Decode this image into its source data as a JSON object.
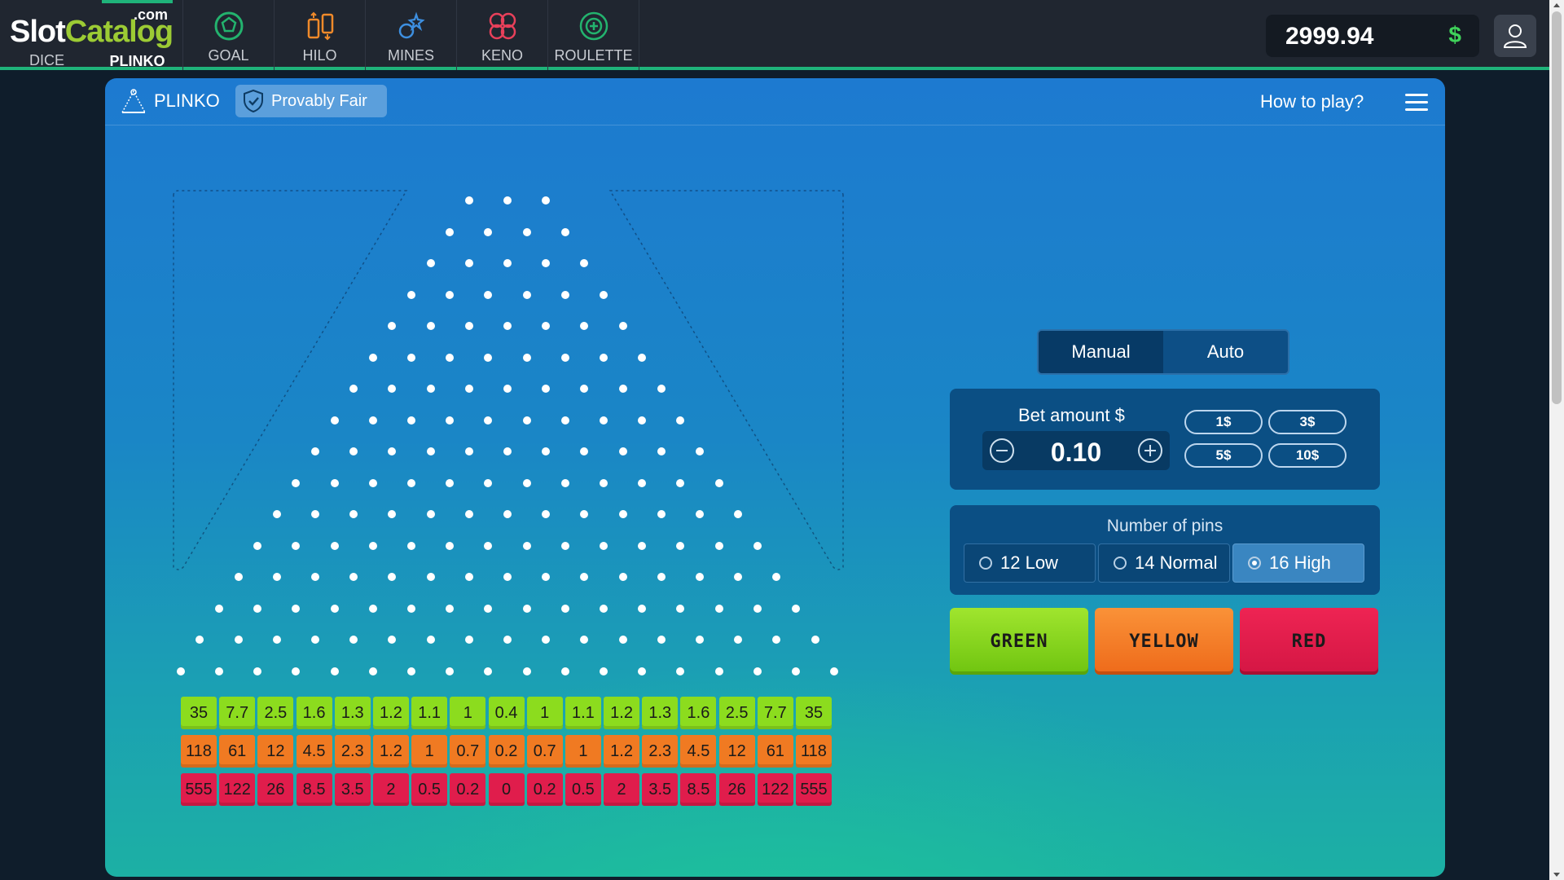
{
  "logo": {
    "brand_white": "Slot",
    "brand_green": "Catalog",
    "suffix": ".com"
  },
  "nav": {
    "items": [
      {
        "label": "DICE",
        "icon": "dice-icon"
      },
      {
        "label": "PLINKO",
        "icon": "plinko-icon",
        "active": true
      },
      {
        "label": "GOAL",
        "icon": "soccer-ball-icon"
      },
      {
        "label": "HILO",
        "icon": "hilo-icon"
      },
      {
        "label": "MINES",
        "icon": "mines-icon"
      },
      {
        "label": "KENO",
        "icon": "keno-icon"
      },
      {
        "label": "ROULETTE",
        "icon": "roulette-icon"
      }
    ]
  },
  "balance": {
    "amount": "2999.94",
    "currency": "$"
  },
  "game": {
    "title": "PLINKO",
    "provably_fair": "Provably Fair",
    "how_to_play": "How to play?"
  },
  "board": {
    "pin_rows": 16,
    "multipliers": {
      "green": [
        "35",
        "7.7",
        "2.5",
        "1.6",
        "1.3",
        "1.2",
        "1.1",
        "1",
        "0.4",
        "1",
        "1.1",
        "1.2",
        "1.3",
        "1.6",
        "2.5",
        "7.7",
        "35"
      ],
      "yellow": [
        "118",
        "61",
        "12",
        "4.5",
        "2.3",
        "1.2",
        "1",
        "0.7",
        "0.2",
        "0.7",
        "1",
        "1.2",
        "2.3",
        "4.5",
        "12",
        "61",
        "118"
      ],
      "red": [
        "555",
        "122",
        "26",
        "8.5",
        "3.5",
        "2",
        "0.5",
        "0.2",
        "0",
        "0.2",
        "0.5",
        "2",
        "3.5",
        "8.5",
        "26",
        "122",
        "555"
      ]
    }
  },
  "controls": {
    "mode": {
      "manual": "Manual",
      "auto": "Auto",
      "selected": "Manual"
    },
    "bet": {
      "label": "Bet amount $",
      "value": "0.10",
      "chips": [
        "1$",
        "3$",
        "5$",
        "10$"
      ]
    },
    "pins": {
      "label": "Number of pins",
      "options": [
        "12 Low",
        "14 Normal",
        "16 High"
      ],
      "selected": "16 High"
    },
    "play": {
      "green": "GREEN",
      "yellow": "YELLOW",
      "red": "RED"
    }
  },
  "colors": {
    "accent": "#1fb37a",
    "green": "#8cdc1e",
    "orange": "#f07a22",
    "red": "#e01d4c"
  }
}
